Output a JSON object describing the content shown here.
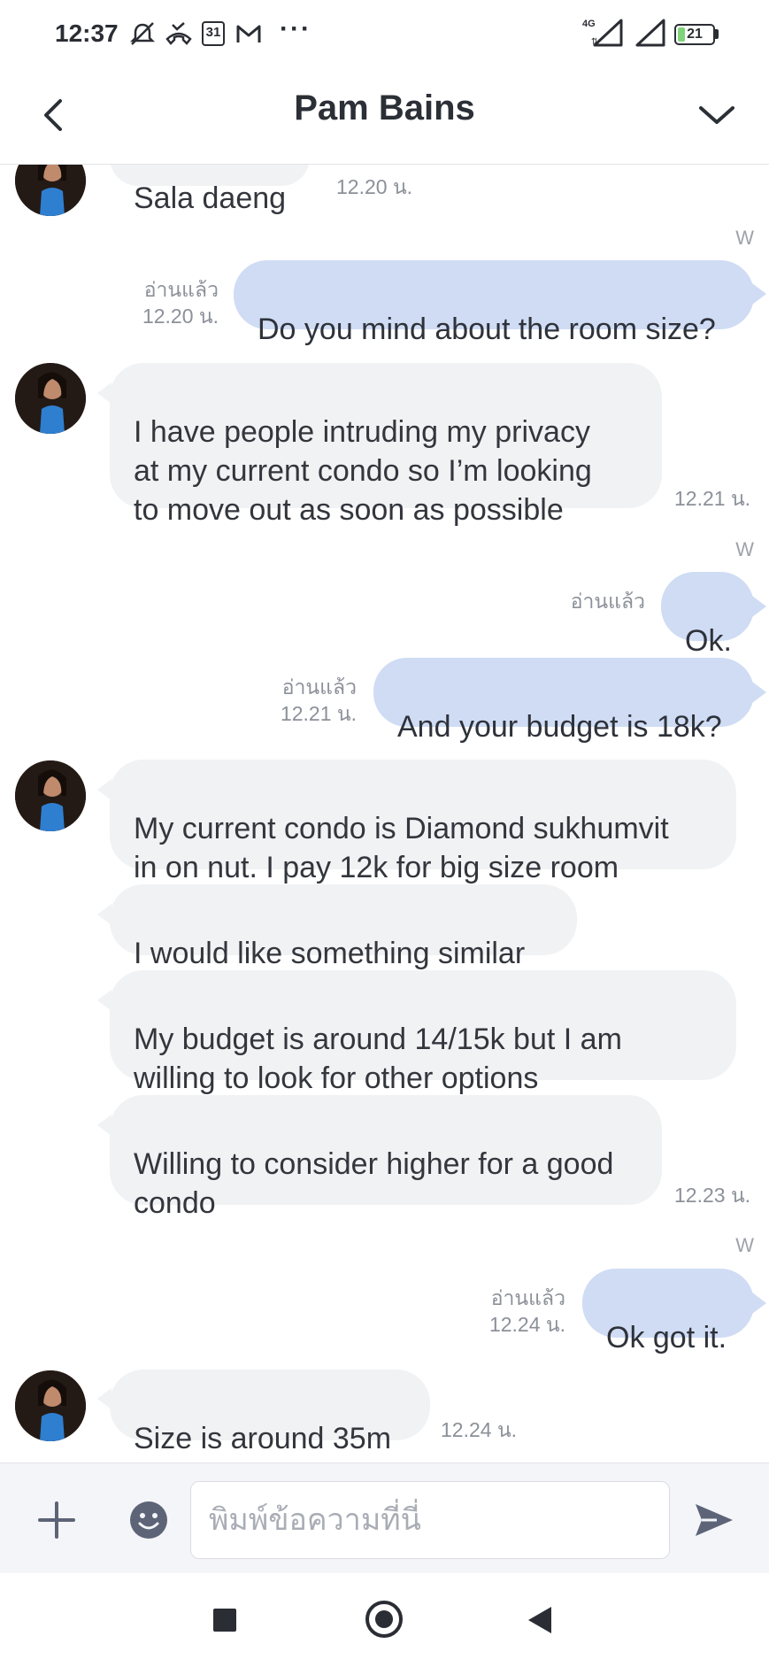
{
  "status_bar": {
    "time": "12:37",
    "calendar_day": "31",
    "more_dots": "···",
    "network": "4G",
    "battery": "21",
    "battery_level": 0.21,
    "icons": [
      "silent-icon",
      "missed-call-icon",
      "calendar-icon",
      "gmail-icon",
      "signal-icon",
      "battery-icon"
    ]
  },
  "header": {
    "title": "Pam Bains",
    "back_icon": "chevron-left-icon",
    "menu_icon": "chevron-down-icon"
  },
  "messages": [
    {
      "from": "them",
      "text": "Sala daeng",
      "time": "12.20 น."
    },
    {
      "from": "me",
      "w": "W",
      "read": "อ่านแล้ว",
      "time": "12.20 น.",
      "text": "Do you mind about the room size?"
    },
    {
      "from": "them",
      "text": "I have people intruding my privacy\nat my current condo so I’m looking\nto move out as soon as possible",
      "time": "12.21 น."
    },
    {
      "from": "me",
      "w": "W",
      "read": "อ่านแล้ว",
      "text": "Ok."
    },
    {
      "from": "me",
      "read": "อ่านแล้ว",
      "time": "12.21 น.",
      "text": "And your budget is 18k?"
    },
    {
      "from": "them",
      "text": "My current condo is Diamond sukhumvit\nin on nut. I pay 12k for big size room"
    },
    {
      "from": "them",
      "text": "I would like something similar"
    },
    {
      "from": "them",
      "text": "My budget is around 14/15k but I am\nwilling to look for other options"
    },
    {
      "from": "them",
      "text": "Willing to consider higher for a good\ncondo",
      "time": "12.23 น."
    },
    {
      "from": "me",
      "w": "W",
      "read": "อ่านแล้ว",
      "time": "12.24 น.",
      "text": "Ok got it."
    },
    {
      "from": "them",
      "text": "Size is around 35m",
      "time": "12.24 น."
    }
  ],
  "input_bar": {
    "placeholder": "พิมพ์ข้อความที่นี่",
    "add_icon": "plus-icon",
    "emoji_icon": "emoji-icon",
    "send_icon": "send-icon"
  },
  "nav_bar": {
    "icons": [
      "recent-apps-icon",
      "home-icon",
      "back-icon"
    ]
  },
  "colors": {
    "incoming_bubble": "#f1f2f4",
    "outgoing_bubble": "#cfdcf4",
    "meta_text": "#8c9099"
  }
}
